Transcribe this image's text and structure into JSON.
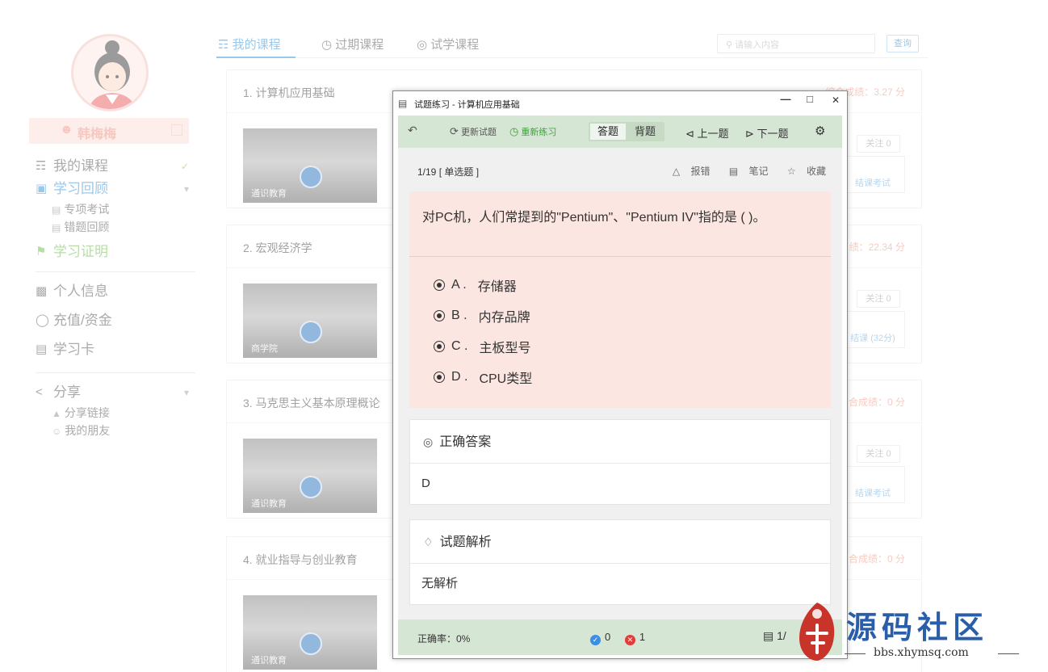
{
  "sidebar": {
    "username": "韩梅梅",
    "menu": {
      "my_courses": "我的课程",
      "review": "学习回顾",
      "review_sub1": "专项考试",
      "review_sub2": "错题回顾",
      "certificate": "学习证明",
      "profile": "个人信息",
      "recharge": "充值/资金",
      "card": "学习卡",
      "share": "分享",
      "share_sub1": "分享链接",
      "share_sub2": "我的朋友"
    }
  },
  "tabs": {
    "my": "我的课程",
    "expired": "过期课程",
    "trial": "试学课程",
    "search_placeholder": "请输入内容",
    "search_btn": "查询"
  },
  "courses": [
    {
      "title": "1. 计算机应用基础",
      "score": "综合成绩：3.27 分",
      "thumb": "通识教育",
      "follow": "关注 0",
      "action": "结课考试"
    },
    {
      "title": "2. 宏观经济学",
      "score": "绩：22.34 分",
      "thumb": "商学院",
      "follow": "关注 0",
      "action": "结课 (32分)"
    },
    {
      "title": "3. 马克思主义基本原理概论",
      "score": "合成绩：0 分",
      "thumb": "通识教育",
      "follow": "关注 0",
      "action": "结课考试"
    },
    {
      "title": "4. 就业指导与创业教育",
      "score": "合成绩：0 分",
      "thumb": "通识教育",
      "follow": "",
      "action": ""
    }
  ],
  "dialog": {
    "title": "试题练习 - 计算机应用基础",
    "toolbar": {
      "update": "更新试题",
      "redo": "重新练习",
      "answer_mode": "答题",
      "recite_mode": "背题",
      "prev": "上一题",
      "next": "下一题"
    },
    "question": {
      "number": "1/19 [ 单选题 ]",
      "report": "报错",
      "note": "笔记",
      "favorite": "收藏",
      "text": "对PC机，人们常提到的\"Pentium\"、\"Pentium IV\"指的是 (        )。",
      "options": [
        {
          "label": "A .",
          "text": "存储器"
        },
        {
          "label": "B .",
          "text": "内存品牌"
        },
        {
          "label": "C .",
          "text": "主板型号"
        },
        {
          "label": "D .",
          "text": "CPU类型"
        }
      ]
    },
    "answer": {
      "heading": "正确答案",
      "value": "D"
    },
    "analysis": {
      "heading": "试题解析",
      "value": "无解析"
    },
    "footer": {
      "accuracy": "正确率：0%",
      "correct_count": "0",
      "wrong_count": "1",
      "page": "1/"
    }
  },
  "watermark": {
    "title": "源码社区",
    "url": "bbs.xhymsq.com"
  }
}
